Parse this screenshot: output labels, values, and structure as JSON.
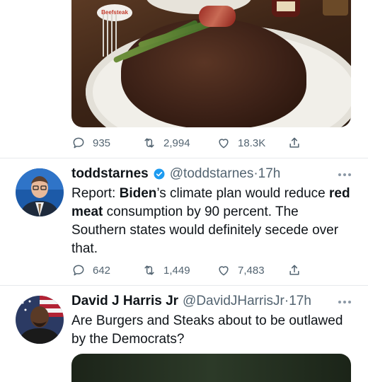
{
  "tweet1": {
    "media_alt": "",
    "sticker_text": "Beefsteak",
    "replies": "935",
    "retweets": "2,994",
    "likes": "18.3K"
  },
  "tweet2": {
    "name": "toddstarnes",
    "handle": "@toddstarnes",
    "time": "17h",
    "text_parts": {
      "p1": "Report: ",
      "b1": "Biden",
      "p2": "’s climate plan would reduce ",
      "b2": "red meat",
      "p3": " consumption by 90 percent. The Southern states would definitely secede over that."
    },
    "replies": "642",
    "retweets": "1,449",
    "likes": "7,483"
  },
  "tweet3": {
    "name": "David J Harris Jr",
    "handle": "@DavidJHarrisJr",
    "time": "17h",
    "text": "Are Burgers and Steaks about to be outlawed by the Democrats?"
  },
  "icons": {
    "reply": "reply-icon",
    "retweet": "retweet-icon",
    "like": "heart-icon",
    "share": "share-icon",
    "verified": "verified-badge-icon",
    "more": "more-options-icon"
  },
  "colors": {
    "text": "#0f1419",
    "secondary": "#536471",
    "verified": "#1d9bf0",
    "divider": "#e6e9ec"
  }
}
